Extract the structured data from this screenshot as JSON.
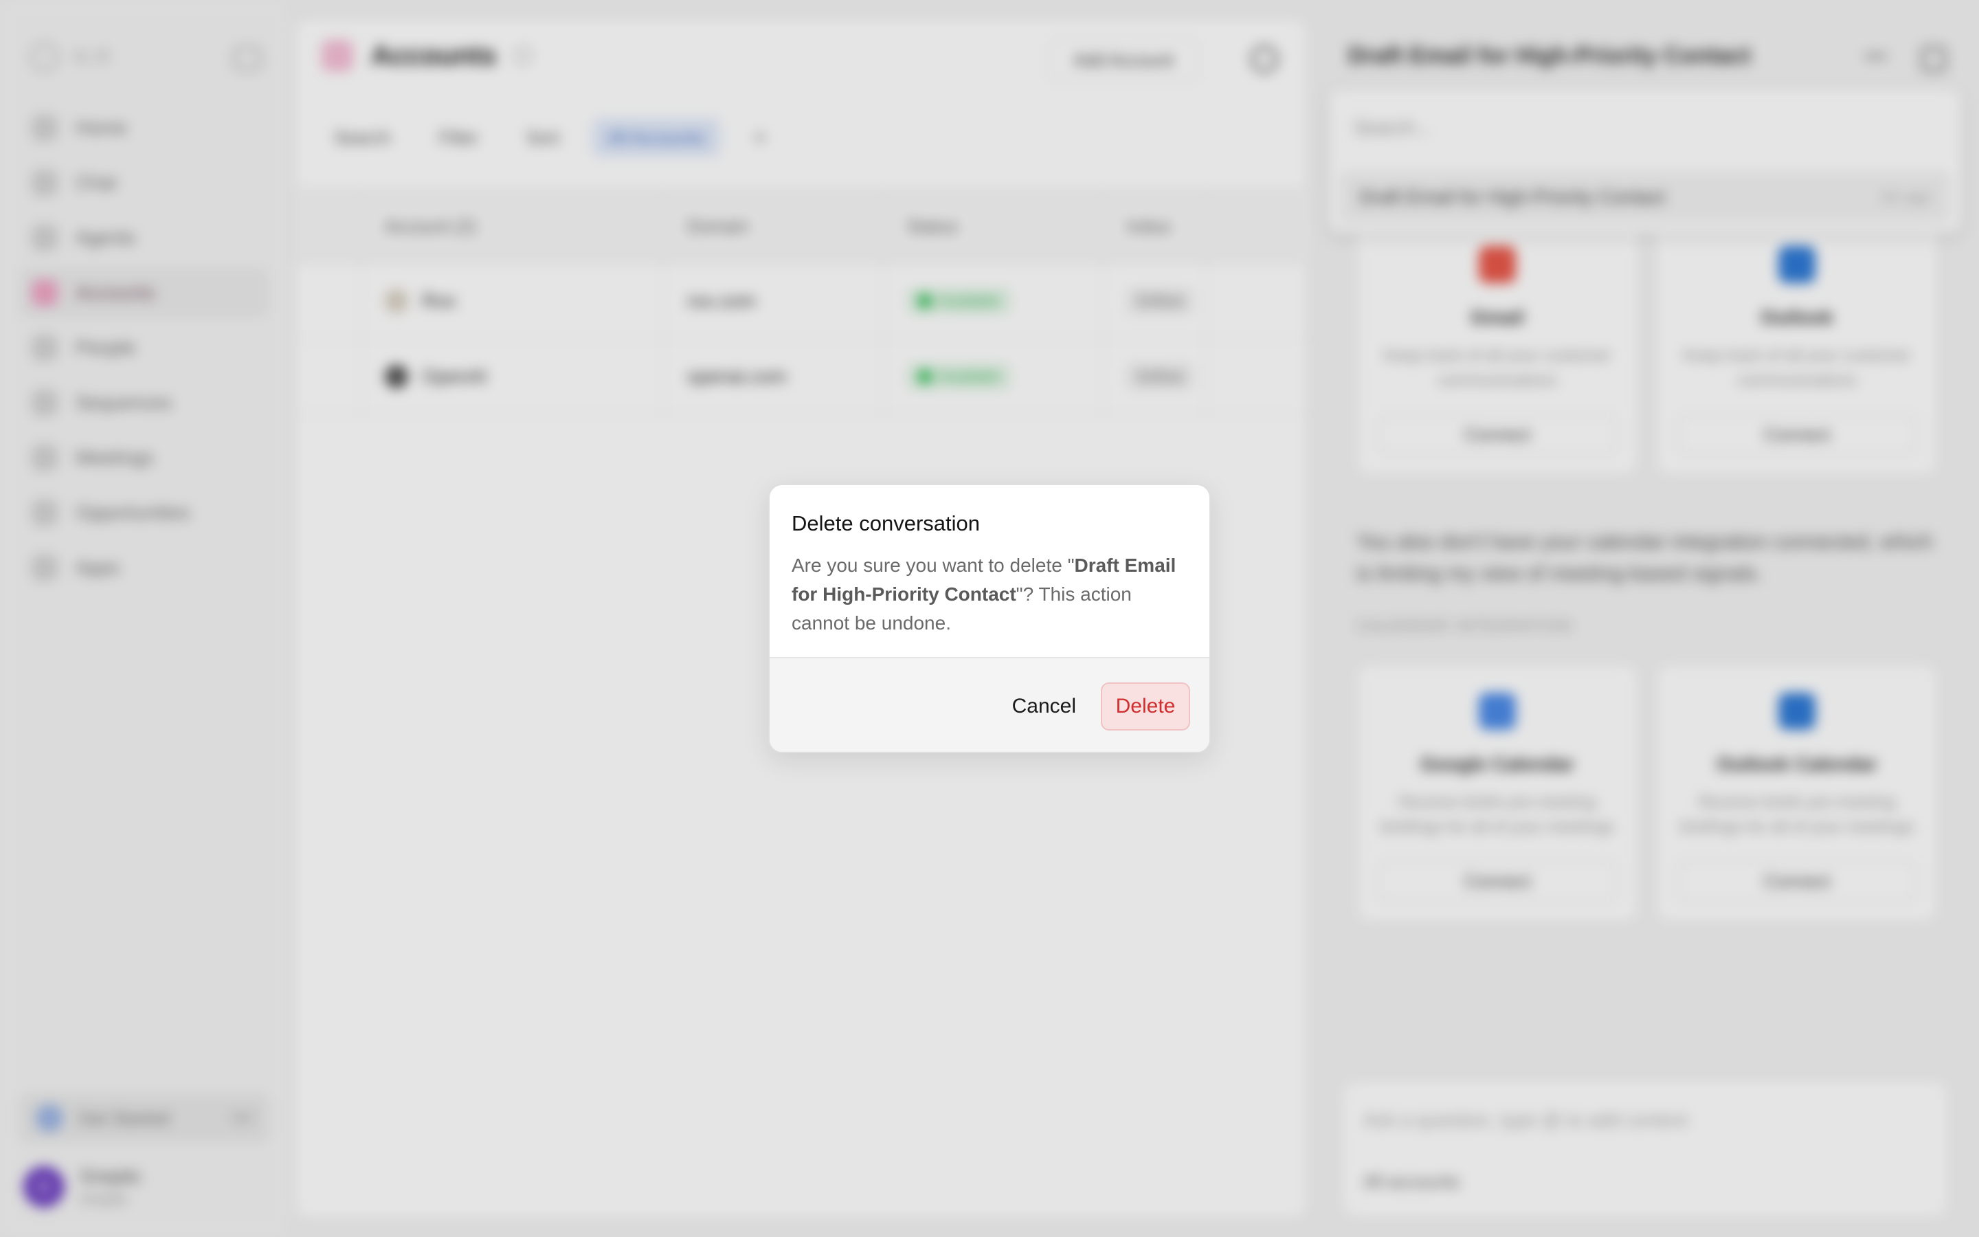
{
  "sidebar": {
    "logo_text": "N.R",
    "nav_items": [
      {
        "label": "Home"
      },
      {
        "label": "Chat"
      },
      {
        "label": "Agents"
      },
      {
        "label": "Accounts"
      },
      {
        "label": "People"
      },
      {
        "label": "Sequences"
      },
      {
        "label": "Meetings"
      },
      {
        "label": "Opportunities"
      },
      {
        "label": "Apps"
      }
    ],
    "get_started_label": "Get Started",
    "get_started_count": "0/4",
    "user_initial": "G",
    "user_name": "Greptic",
    "user_sub": "Greptic"
  },
  "main": {
    "title": "Accounts",
    "add_account_label": "Add Account",
    "toolbar": {
      "search_label": "Search",
      "filter_label": "Filter",
      "sort_label": "Sort",
      "view_chip_label": "All Accounts",
      "add_label": "+"
    },
    "table": {
      "headers": [
        "Account (2)",
        "Domain",
        "Status",
        "Indus"
      ],
      "rows": [
        {
          "account": "Rox",
          "domain": "rox.com",
          "status": "Available",
          "industry": "Softwa"
        },
        {
          "account": "OpenAI",
          "domain": "openai.com",
          "status": "Available",
          "industry": "Softwa"
        }
      ]
    }
  },
  "right_panel": {
    "title": "Draft Email for High-Priority Contact",
    "dropdown": {
      "search_placeholder": "Search...",
      "item_label": "Draft Email for High-Priority Contact",
      "item_time": "2m ago"
    },
    "email_cards": [
      {
        "title": "Gmail",
        "desc": "Keep track of all your customer communications",
        "button": "Connect"
      },
      {
        "title": "Outlook",
        "desc": "Keep track of all your customer communications",
        "button": "Connect"
      }
    ],
    "calendar_text": "You also don't have your calendar integration connected, which is limiting my view of meeting-based signals.",
    "calendar_section_label": "CALENDAR INTEGRATION",
    "calendar_cards": [
      {
        "title": "Google Calendar",
        "desc": "Receive briefs pre-meeting briefings for all of your meetings",
        "button": "Connect"
      },
      {
        "title": "Outlook Calendar",
        "desc": "Receive briefs pre-meeting briefings for all of your meetings",
        "button": "Connect"
      }
    ],
    "chat_placeholder": "Ask a question, type @ to add context",
    "chat_scope": "All accounts"
  },
  "modal": {
    "title": "Delete conversation",
    "text_prefix": "Are you sure you want to delete \"",
    "conversation_name": "Draft Email for High-Priority Contact",
    "text_suffix": "\"? This action cannot be undone.",
    "cancel_label": "Cancel",
    "delete_label": "Delete"
  },
  "colors": {
    "delete_text": "#cf2f2f",
    "delete_bg": "#fae1e1",
    "accent_pink": "#f0a5c4",
    "status_green": "#3bc15e"
  }
}
